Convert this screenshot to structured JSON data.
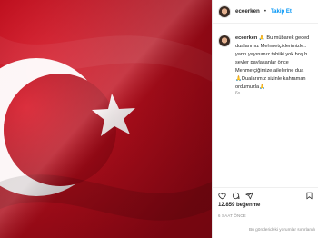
{
  "post": {
    "username": "eceerken",
    "separator": "•",
    "follow_label": "Takip Et",
    "caption_username": "eceerken",
    "caption_lines": [
      "Bu mübarek geced",
      "dualarımız Mehmetçiklerimizle..",
      "yanrı yayınımız tabiiki yok.boş b",
      "şeyler paylaşanlar önce",
      "Mehmetçiğimize,ailelerine dua",
      "Dualarımız sizinle kahraman",
      "ordumuzla"
    ],
    "caption_time": "6s",
    "likes": "12.859 beğenme",
    "posted_ago": "6 SAAT ÖNCE",
    "comments_limited": "Bu gönderideki yorumlar sınırlandı"
  },
  "colors": {
    "flag_red": "#c70d1c",
    "link_blue": "#0095f6"
  },
  "icons": {
    "like": "heart-icon",
    "comment": "comment-icon",
    "share": "share-icon",
    "save": "bookmark-icon"
  }
}
